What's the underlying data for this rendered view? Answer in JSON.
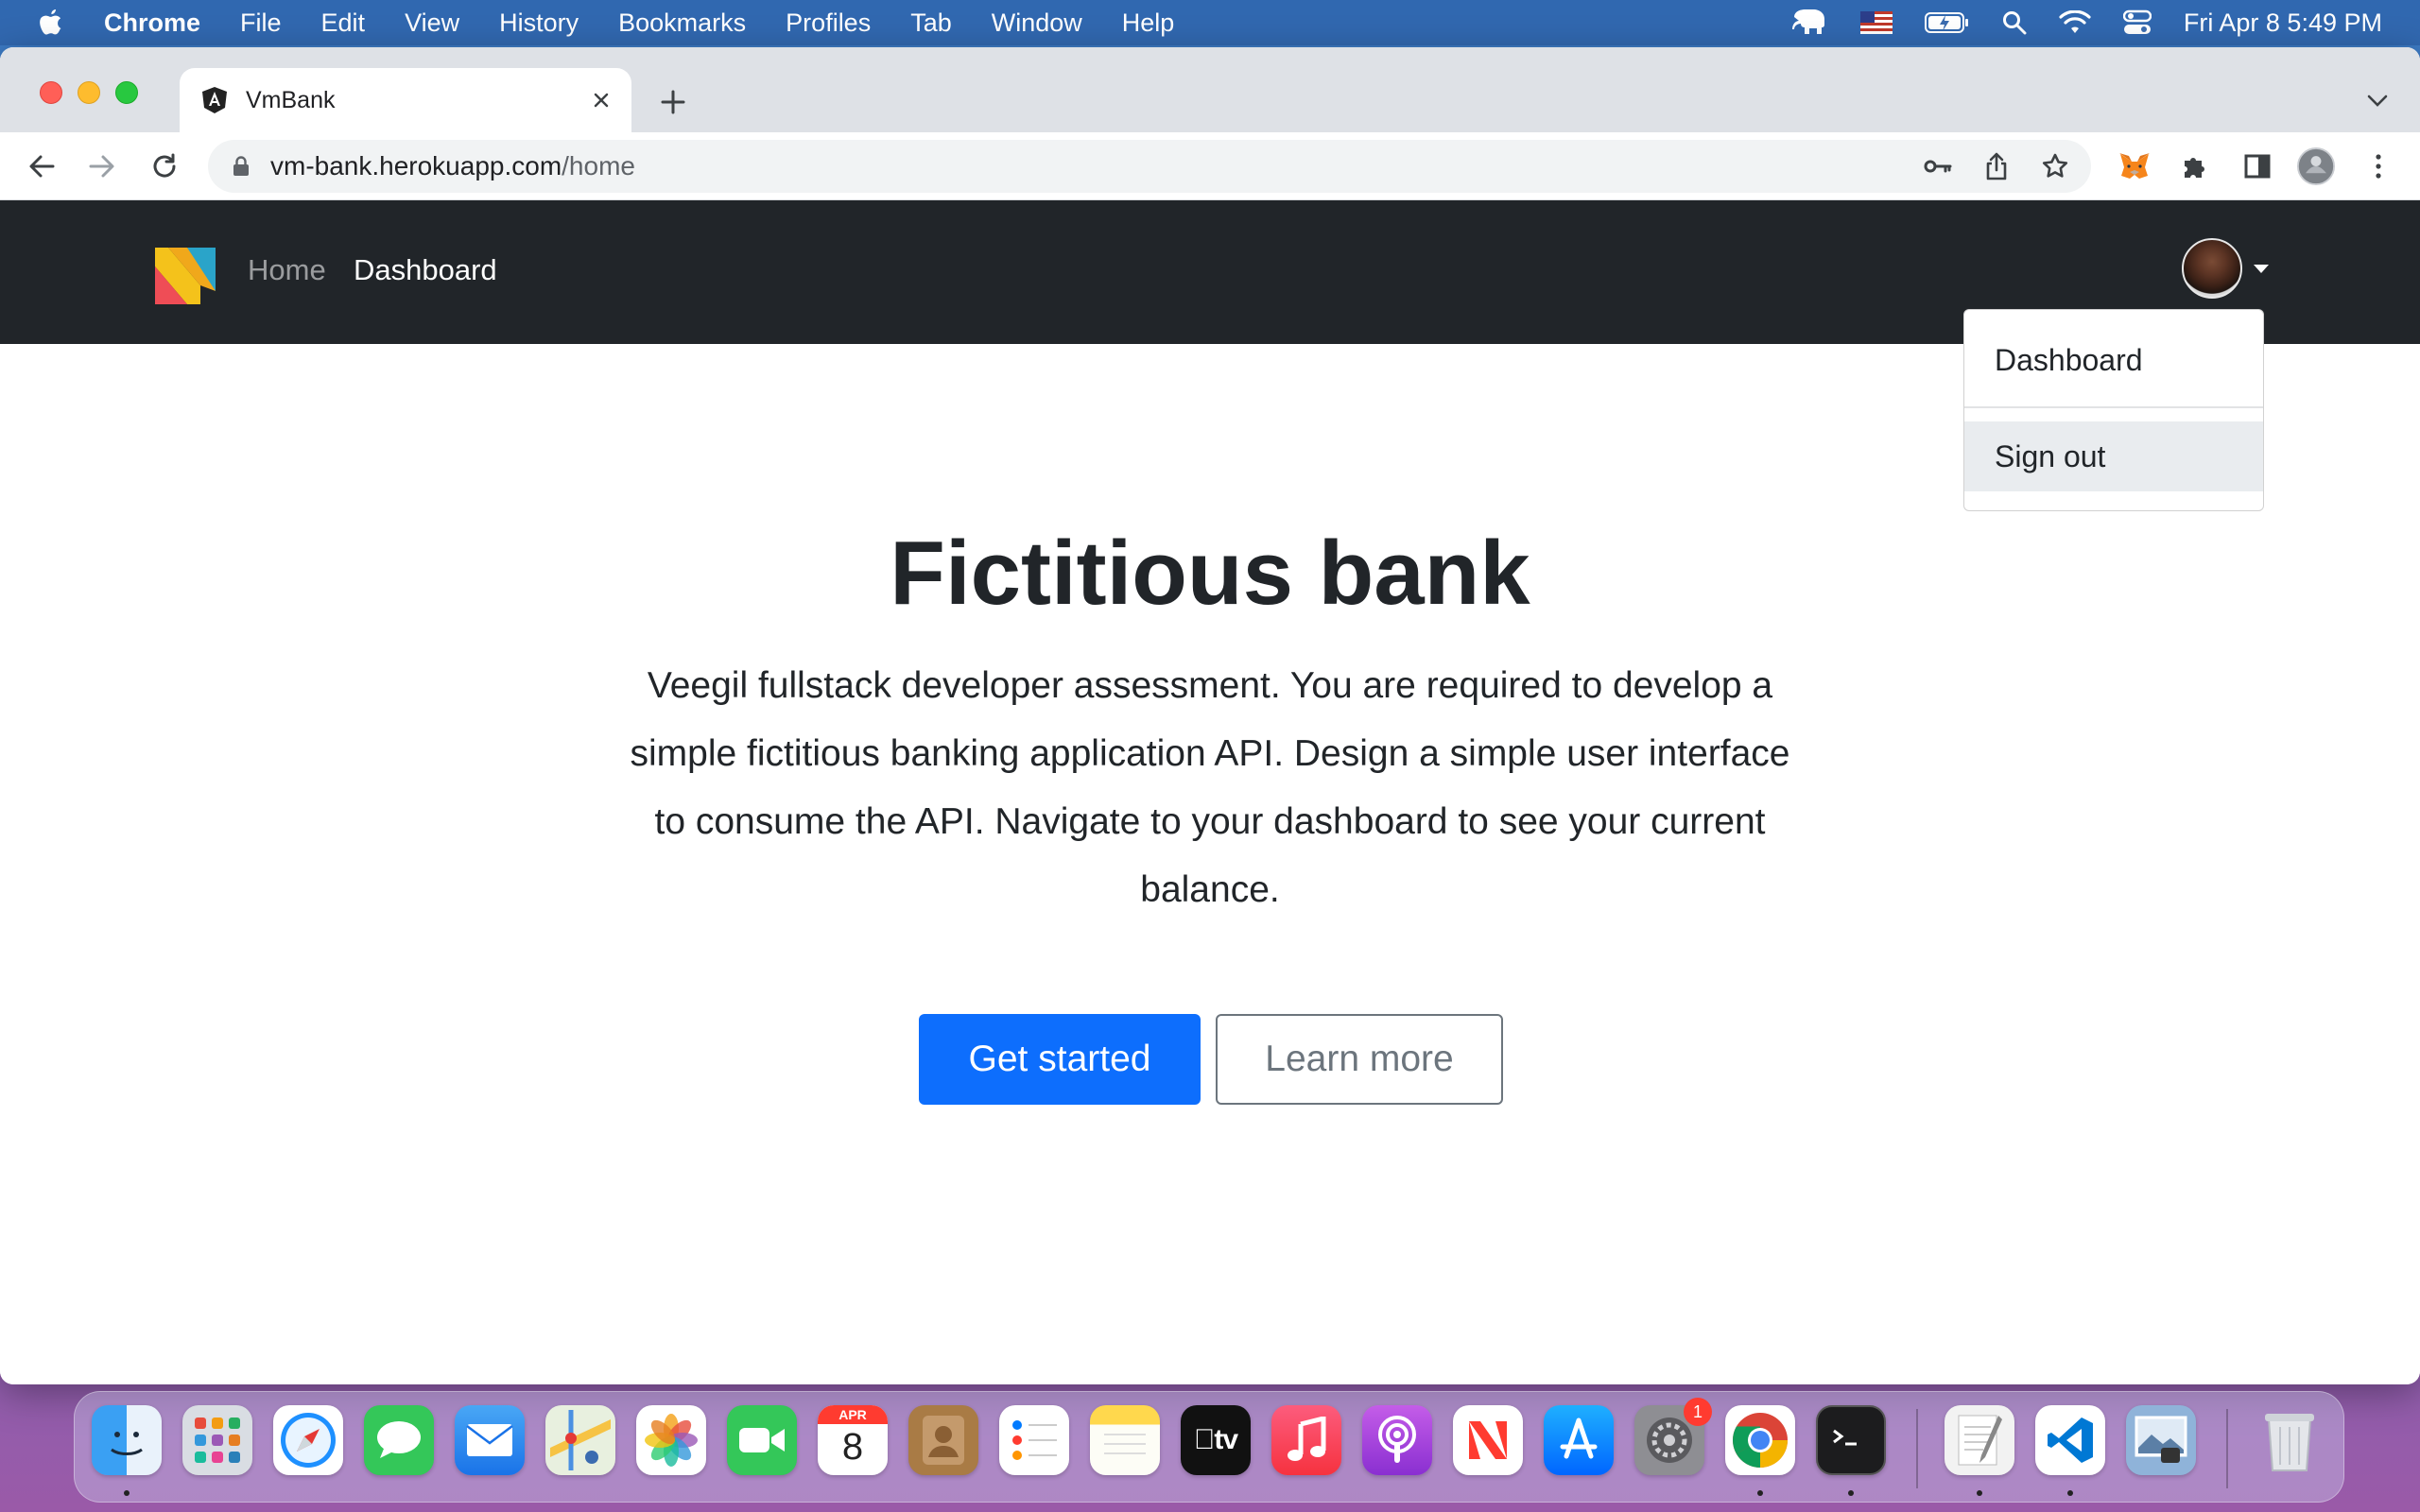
{
  "menubar": {
    "app_name": "Chrome",
    "items": [
      "File",
      "Edit",
      "View",
      "History",
      "Bookmarks",
      "Profiles",
      "Tab",
      "Window",
      "Help"
    ],
    "clock": "Fri Apr 8  5:49 PM"
  },
  "browser": {
    "tab_title": "VmBank",
    "url_host": "vm-bank.herokuapp.com",
    "url_path": "/home"
  },
  "site": {
    "nav": {
      "home_label": "Home",
      "dashboard_label": "Dashboard"
    },
    "user_menu": {
      "items": [
        {
          "label": "Dashboard"
        },
        {
          "label": "Sign out"
        }
      ]
    },
    "hero": {
      "title": "Fictitious bank",
      "text": "Veegil fullstack developer assessment. You are required to develop a simple fictitious banking application API. Design a simple user interface to consume the API. Navigate to your dashboard to see your current balance.",
      "primary_button": "Get started",
      "secondary_button": "Learn more"
    }
  },
  "dock": {
    "calendar_month": "APR",
    "calendar_day": "8",
    "settings_badge": "1"
  },
  "colors": {
    "navbar_bg": "#212529",
    "primary": "#0d6efd",
    "secondary": "#6c757d"
  }
}
